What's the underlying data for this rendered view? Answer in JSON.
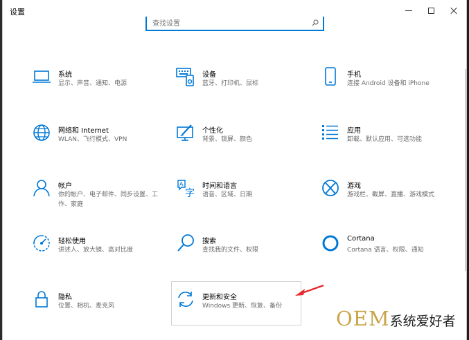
{
  "window": {
    "title": "设置"
  },
  "search": {
    "placeholder": "查找设置"
  },
  "tiles": [
    {
      "id": "system",
      "icon": "laptop-icon",
      "title": "系统",
      "desc": "显示、声音、通知、电源"
    },
    {
      "id": "devices",
      "icon": "keyboard-device-icon",
      "title": "设备",
      "desc": "蓝牙、打印机、鼠标"
    },
    {
      "id": "phone",
      "icon": "phone-icon",
      "title": "手机",
      "desc": "连接 Android 设备和 iPhone"
    },
    {
      "id": "network",
      "icon": "globe-icon",
      "title": "网络和 Internet",
      "desc": "WLAN、飞行模式、VPN"
    },
    {
      "id": "personalization",
      "icon": "paintbrush-monitor-icon",
      "title": "个性化",
      "desc": "背景、锁屏、颜色"
    },
    {
      "id": "apps",
      "icon": "app-list-icon",
      "title": "应用",
      "desc": "卸载、默认应用、可选功能"
    },
    {
      "id": "accounts",
      "icon": "person-icon",
      "title": "帐户",
      "desc": "你的帐户、电子邮件、同步设置、工作、家庭"
    },
    {
      "id": "time-language",
      "icon": "language-clock-icon",
      "title": "时间和语言",
      "desc": "语音、区域、日期"
    },
    {
      "id": "gaming",
      "icon": "xbox-icon",
      "title": "游戏",
      "desc": "游戏栏、截屏、直播、游戏模式"
    },
    {
      "id": "ease-of-access",
      "icon": "ease-of-access-icon",
      "title": "轻松使用",
      "desc": "讲述人、放大镜、高对比度"
    },
    {
      "id": "search",
      "icon": "magnifier-icon",
      "title": "搜索",
      "desc": "查找我的文件、权限"
    },
    {
      "id": "cortana",
      "icon": "cortana-ring-icon",
      "title": "Cortana",
      "desc": "Cortana 语言、权限、通知"
    },
    {
      "id": "privacy",
      "icon": "lock-icon",
      "title": "隐私",
      "desc": "位置、相机、麦克风"
    },
    {
      "id": "update-security",
      "icon": "sync-arrows-icon",
      "title": "更新和安全",
      "desc": "Windows 更新、恢复、备份"
    }
  ],
  "watermark": {
    "brand": "OEM",
    "text": "系统爱好者"
  },
  "colors": {
    "accent": "#0078d7",
    "arrow": "#e8292b",
    "watermark_gold": "#c9a54a"
  }
}
